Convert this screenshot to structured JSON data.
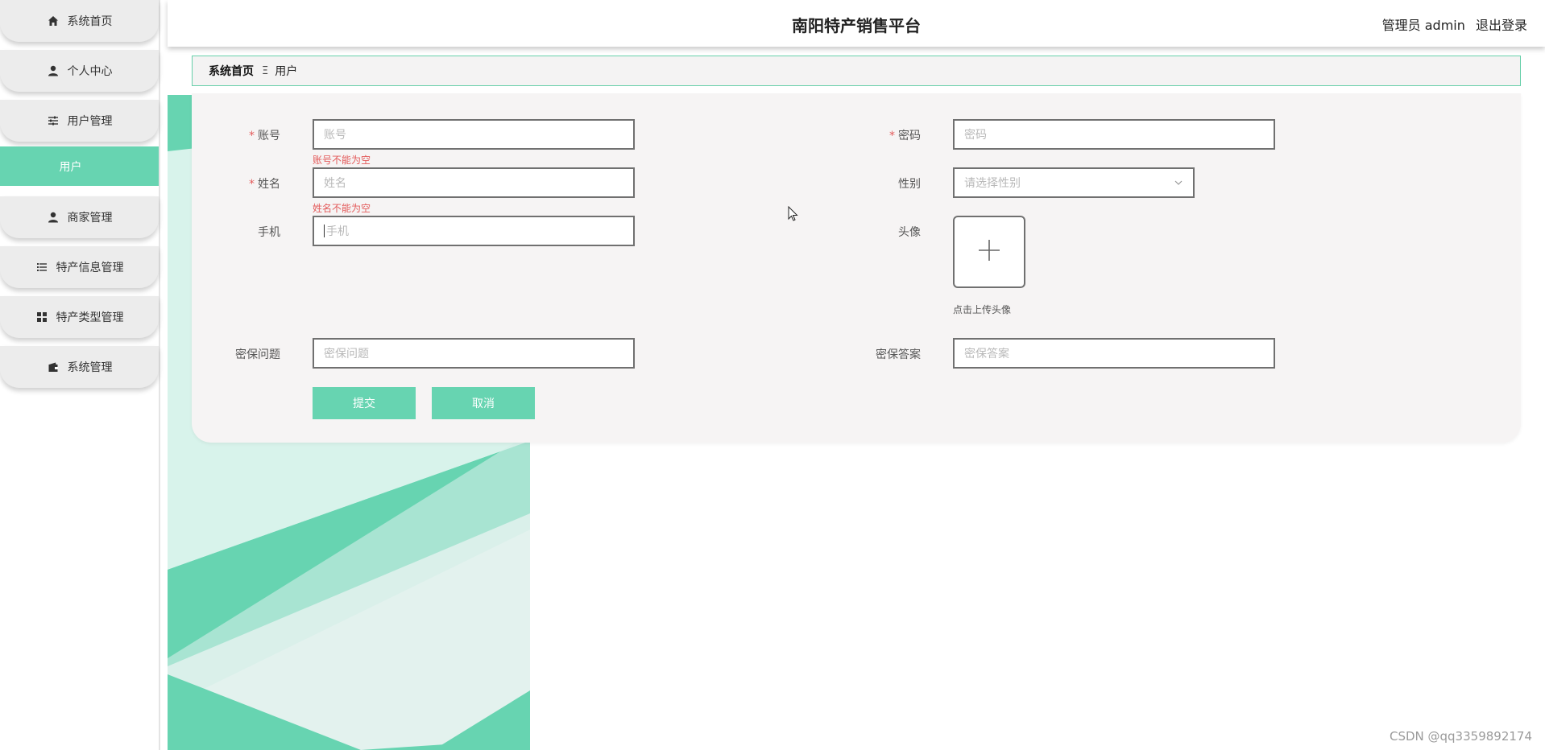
{
  "app": {
    "title": "南阳特产销售平台",
    "user_label": "管理员 admin",
    "logout_label": "退出登录"
  },
  "sidebar": {
    "items": [
      {
        "label": "系统首页",
        "icon": "home-icon"
      },
      {
        "label": "个人中心",
        "icon": "user-icon"
      },
      {
        "label": "用户管理",
        "icon": "sliders-icon"
      },
      {
        "label": "商家管理",
        "icon": "user-icon"
      },
      {
        "label": "特产信息管理",
        "icon": "list-icon"
      },
      {
        "label": "特产类型管理",
        "icon": "grid-icon"
      },
      {
        "label": "系统管理",
        "icon": "wallet-icon"
      }
    ],
    "active_sub": "用户"
  },
  "breadcrumb": {
    "home": "系统首页",
    "separator": "Ξ",
    "current": "用户"
  },
  "form": {
    "account": {
      "label": "账号",
      "placeholder": "账号",
      "error": "账号不能为空",
      "required": true
    },
    "password": {
      "label": "密码",
      "placeholder": "密码",
      "required": true
    },
    "name": {
      "label": "姓名",
      "placeholder": "姓名",
      "error": "姓名不能为空",
      "required": true
    },
    "gender": {
      "label": "性别",
      "placeholder": "请选择性别"
    },
    "phone": {
      "label": "手机",
      "placeholder": "手机"
    },
    "avatar": {
      "label": "头像",
      "hint": "点击上传头像"
    },
    "security_question": {
      "label": "密保问题",
      "placeholder": "密保问题"
    },
    "security_answer": {
      "label": "密保答案",
      "placeholder": "密保答案"
    },
    "submit_label": "提交",
    "cancel_label": "取消"
  },
  "watermark": "CSDN @qq3359892174",
  "colors": {
    "accent": "#67d4b1",
    "error": "#e35a5a"
  }
}
